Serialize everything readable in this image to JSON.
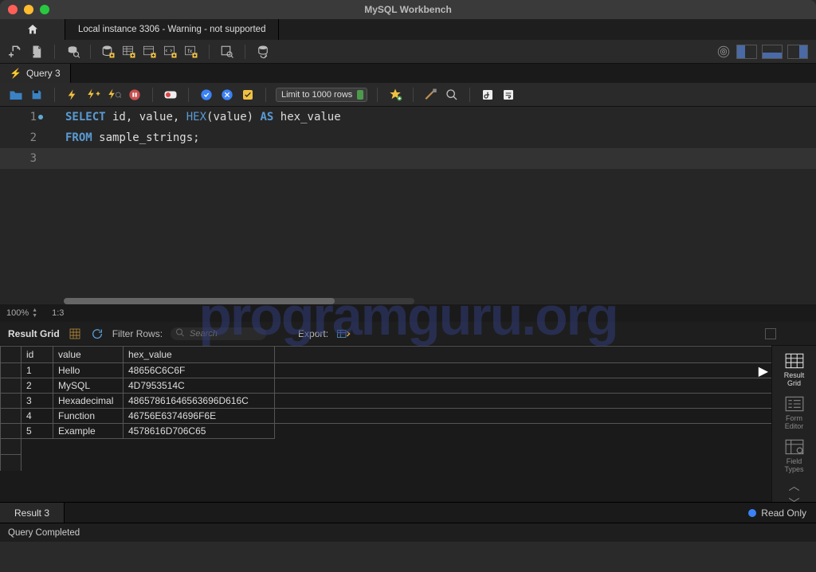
{
  "title": "MySQL Workbench",
  "connection_tab": "Local instance 3306 - Warning - not supported",
  "query_tab": "Query 3",
  "limit_label": "Limit to 1000 rows",
  "editor": {
    "lines": [
      {
        "n": 1,
        "dot": true
      },
      {
        "n": 2
      },
      {
        "n": 3,
        "current": true
      }
    ],
    "sql_line1": {
      "kw1": "SELECT",
      "col1": " id",
      "c1": ",",
      "col2": " value",
      "c2": ",",
      "fn": " HEX",
      "p1": "(",
      "arg": "value",
      "p2": ")",
      "kw2": " AS",
      "alias": " hex_value"
    },
    "sql_line2": {
      "kw1": "FROM",
      "tbl": " sample_strings",
      "semi": ";"
    }
  },
  "zoom": "100%",
  "cursor_pos": "1:3",
  "result_toolbar": {
    "label": "Result Grid",
    "filter_label": "Filter Rows:",
    "filter_placeholder": "Search",
    "export_label": "Export:"
  },
  "columns": [
    "id",
    "value",
    "hex_value"
  ],
  "rows": [
    {
      "id": "1",
      "value": "Hello",
      "hex_value": "48656C6C6F"
    },
    {
      "id": "2",
      "value": "MySQL",
      "hex_value": "4D7953514C"
    },
    {
      "id": "3",
      "value": "Hexadecimal",
      "hex_value": "48657861646563696D616C"
    },
    {
      "id": "4",
      "value": "Function",
      "hex_value": "46756E6374696F6E"
    },
    {
      "id": "5",
      "value": "Example",
      "hex_value": "4578616D706C65"
    }
  ],
  "side_panels": {
    "result_grid": "Result\nGrid",
    "form_editor": "Form\nEditor",
    "field_types": "Field\nTypes"
  },
  "result_tab": "Result 3",
  "readonly_label": "Read Only",
  "status": "Query Completed",
  "watermark": "programguru.org"
}
